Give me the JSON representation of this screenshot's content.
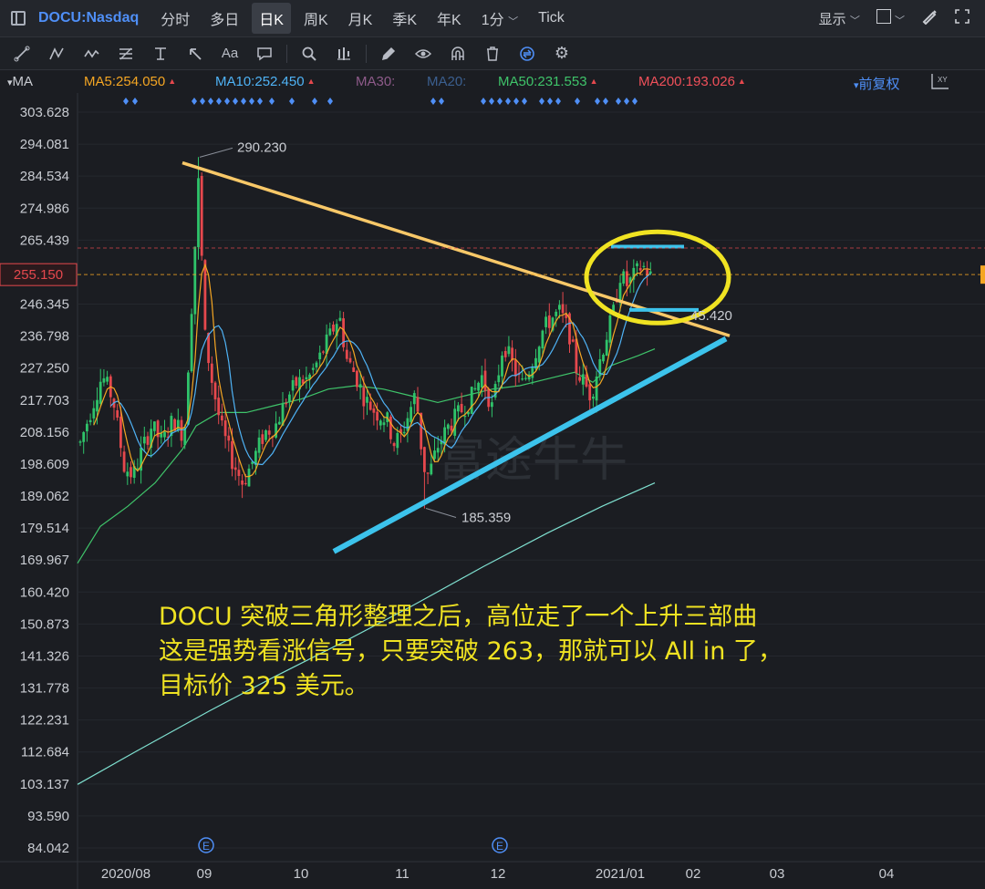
{
  "topbar": {
    "symbol": "DOCU:Nasdaq",
    "periods": [
      "分时",
      "多日",
      "日K",
      "周K",
      "月K",
      "季K",
      "年K"
    ],
    "active_period": "日K",
    "interval": "1分",
    "tick": "Tick",
    "display_label": "显示"
  },
  "ma_bar": {
    "label": "MA",
    "items": [
      {
        "text": "MA5:254.050",
        "color": "#f5a623",
        "arrow": true
      },
      {
        "text": "MA10:252.450",
        "color": "#4fb3f6",
        "arrow": true
      },
      {
        "text": "MA30:",
        "color": "#8e5b8a",
        "arrow": false
      },
      {
        "text": "MA20:",
        "color": "#3b5f8f",
        "arrow": false
      },
      {
        "text": "MA50:231.553",
        "color": "#3fc46a",
        "arrow": true
      },
      {
        "text": "MA200:193.026",
        "color": "#f0505a",
        "arrow": true
      }
    ],
    "adjust_label": "前复权"
  },
  "y_axis": {
    "ticks": [
      "303.628",
      "294.081",
      "284.534",
      "274.986",
      "265.439",
      "246.345",
      "236.798",
      "227.250",
      "217.703",
      "208.156",
      "198.609",
      "189.062",
      "179.514",
      "169.967",
      "160.420",
      "150.873",
      "141.326",
      "131.778",
      "122.231",
      "112.684",
      "103.137",
      "93.590",
      "84.042"
    ],
    "current_price": "255.150"
  },
  "x_axis": {
    "ticks": [
      "2020/08",
      "09",
      "10",
      "11",
      "12",
      "2021/01",
      "02",
      "03",
      "04"
    ]
  },
  "chart_data": {
    "type": "candlestick",
    "ylim": [
      84.042,
      303.628
    ],
    "high_label": "290.230",
    "low_label": "185.359",
    "clipped_label_tail": "45.420",
    "current_price": 255.15,
    "resistance_price": 263.0,
    "event_markers": [
      "E",
      "E"
    ],
    "moving_averages": {
      "MA5": 254.05,
      "MA10": 252.45,
      "MA50": 231.553,
      "MA200": 193.026
    }
  },
  "annotation": {
    "lines": [
      "DOCU 突破三角形整理之后，高位走了一个上升三部曲",
      "这是强势看涨信号，只要突破 263，那就可以 All in 了，",
      "目标价 325 美元。"
    ]
  },
  "watermark": "富途牛牛",
  "colors": {
    "up": "#2fc36a",
    "down": "#e5484d",
    "trend_upper": "#f8c868",
    "trend_lower": "#3cc3ec",
    "highlight_circle": "#f0e322",
    "annotation": "#f0e322",
    "price_tag": "#e5484d"
  }
}
